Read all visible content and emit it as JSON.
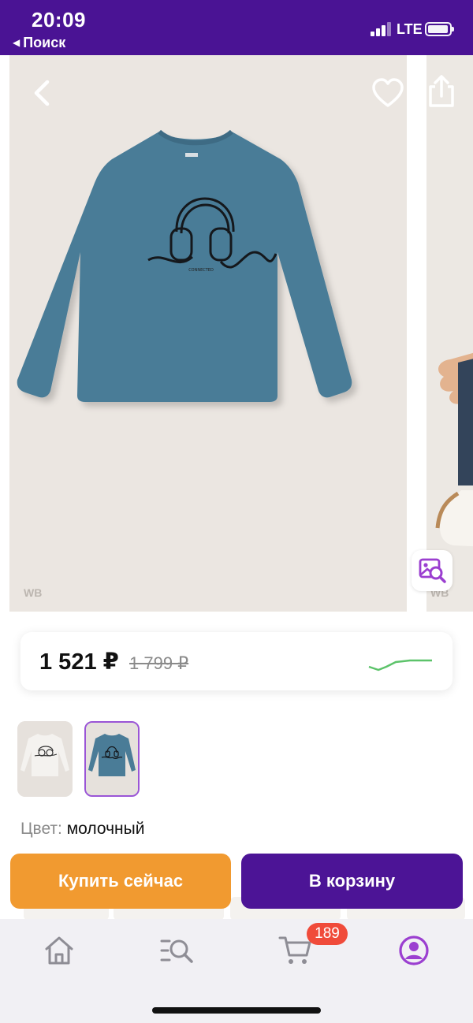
{
  "status_bar": {
    "time": "20:09",
    "back_app": "Поиск",
    "network": "LTE"
  },
  "gallery": {
    "watermark": "WB",
    "watermark_next": "WB",
    "icons": {
      "back": "chevron-left-icon",
      "favorite": "heart-icon",
      "share": "share-icon",
      "visual_search": "image-search-icon"
    }
  },
  "product": {
    "price_current": "1 521 ₽",
    "price_old": "1 799 ₽",
    "price_trend_color": "#5cc36a"
  },
  "color": {
    "label": "Цвет:",
    "value": "молочный",
    "options": [
      {
        "name": "white",
        "shirt_color": "#f4f2ef",
        "selected": false
      },
      {
        "name": "blue",
        "shirt_color": "#4a7c97",
        "selected": true
      }
    ]
  },
  "actions": {
    "buy_now": "Купить сейчас",
    "add_to_cart": "В корзину"
  },
  "tabbar": {
    "cart_count": "189",
    "items": [
      "home-icon",
      "catalog-search-icon",
      "cart-icon",
      "profile-icon"
    ]
  },
  "colors": {
    "brand": "#4a1394",
    "buy": "#f19a30",
    "cart": "#4c1496",
    "badge": "#f04b3a",
    "active_tab": "#9b3fd0"
  }
}
